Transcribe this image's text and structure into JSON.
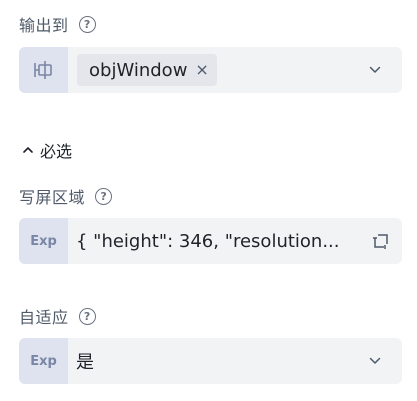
{
  "output_to": {
    "label": "输出到",
    "tag_value": "objWindow",
    "tag_remove_icon": "close-icon",
    "dropdown_icon": "chevron-down-icon",
    "prefix_icon": "variable-icon"
  },
  "required_section": {
    "label": "必选",
    "icon": "chevron-up-icon"
  },
  "write_screen_area": {
    "label": "写屏区域",
    "prefix": "Exp",
    "value": "{ \"height\": 346, \"resolution...",
    "action_icon": "expand-icon"
  },
  "adaptive": {
    "label": "自适应",
    "prefix": "Exp",
    "value": "是",
    "dropdown_icon": "chevron-down-icon"
  },
  "help_icon_glyph": "?",
  "colors": {
    "field_bg": "#f2f3f5",
    "prefix_bg": "#dfe3ef",
    "tag_bg": "#e4e6eb",
    "label": "#4e5969"
  }
}
